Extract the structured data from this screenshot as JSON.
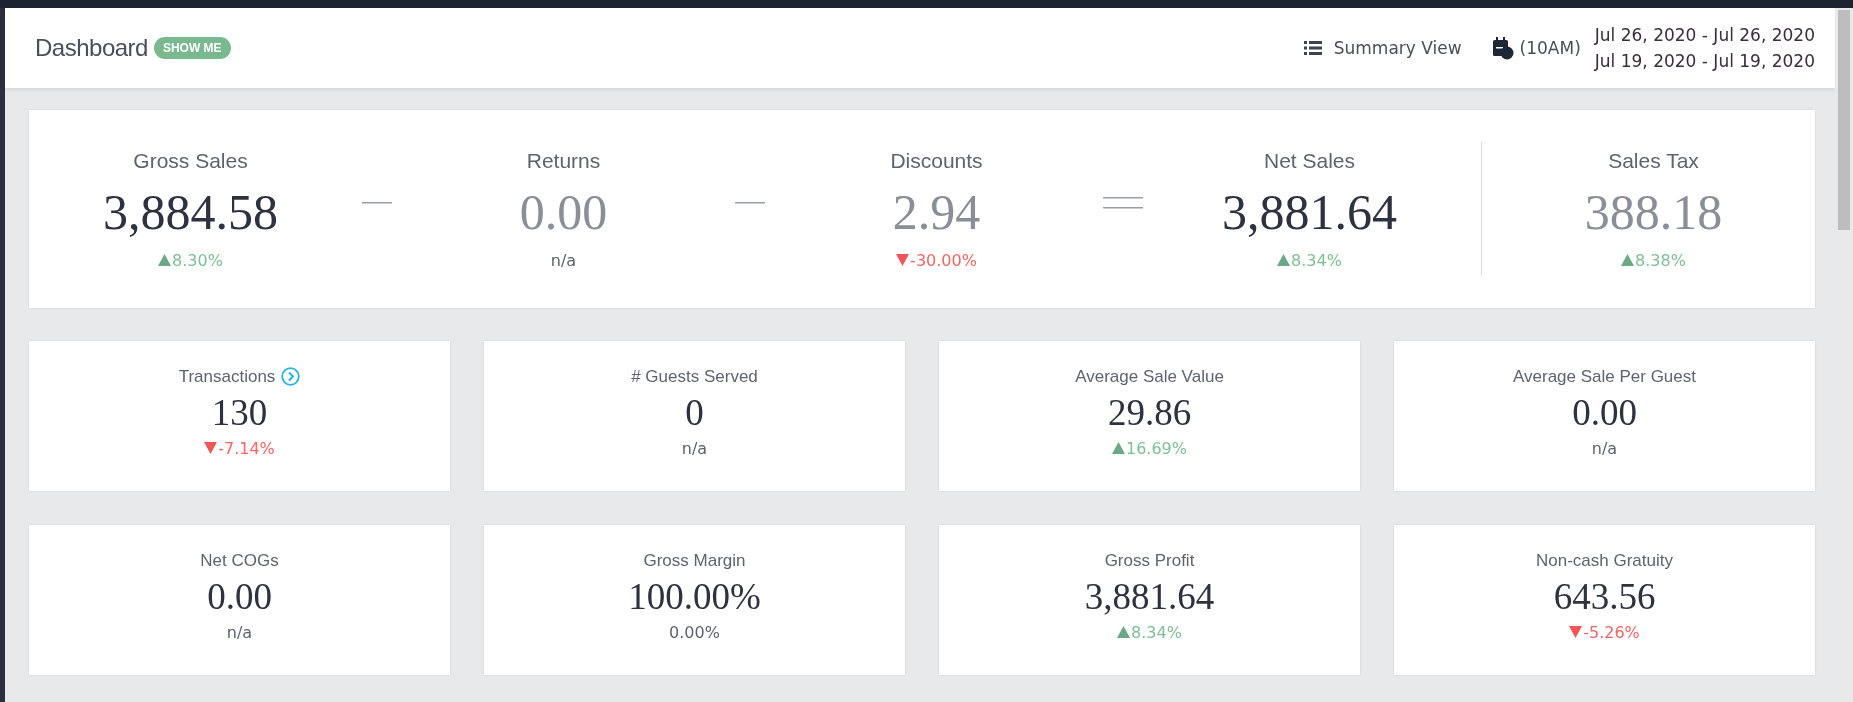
{
  "header": {
    "title": "Dashboard",
    "badge": "SHOW ME",
    "view_button": "Summary View",
    "time_button": "(10AM)",
    "date_ranges": [
      "Jul 26, 2020 - Jul 26, 2020",
      "Jul 19, 2020 - Jul 19, 2020"
    ]
  },
  "summary": [
    {
      "kind": "figure",
      "label": "Gross Sales",
      "value": "3,884.58",
      "muted": false,
      "change": {
        "kind": "up",
        "text": "8.30%"
      }
    },
    {
      "kind": "minus"
    },
    {
      "kind": "figure",
      "label": "Returns",
      "value": "0.00",
      "muted": true,
      "change": {
        "kind": "none",
        "text": "n/a"
      }
    },
    {
      "kind": "minus"
    },
    {
      "kind": "figure",
      "label": "Discounts",
      "value": "2.94",
      "muted": true,
      "change": {
        "kind": "down",
        "text": "-30.00%"
      }
    },
    {
      "kind": "equals"
    },
    {
      "kind": "figure",
      "label": "Net Sales",
      "value": "3,881.64",
      "muted": false,
      "change": {
        "kind": "up",
        "text": "8.34%"
      }
    },
    {
      "kind": "divider"
    },
    {
      "kind": "figure",
      "label": "Sales Tax",
      "value": "388.18",
      "muted": true,
      "change": {
        "kind": "up",
        "text": "8.38%"
      }
    }
  ],
  "metrics": [
    {
      "label": "Transactions",
      "value": "130",
      "change": {
        "kind": "down",
        "text": "-7.14%"
      },
      "link": true
    },
    {
      "label": "# Guests Served",
      "value": "0",
      "change": {
        "kind": "none",
        "text": "n/a"
      },
      "link": false
    },
    {
      "label": "Average Sale Value",
      "value": "29.86",
      "change": {
        "kind": "up",
        "text": "16.69%"
      },
      "link": false
    },
    {
      "label": "Average Sale Per Guest",
      "value": "0.00",
      "change": {
        "kind": "none",
        "text": "n/a"
      },
      "link": false
    },
    {
      "label": "Net COGs",
      "value": "0.00",
      "change": {
        "kind": "none",
        "text": "n/a"
      },
      "link": false
    },
    {
      "label": "Gross Margin",
      "value": "100.00%",
      "change": {
        "kind": "none",
        "text": "0.00%"
      },
      "link": false
    },
    {
      "label": "Gross Profit",
      "value": "3,881.64",
      "change": {
        "kind": "up",
        "text": "8.34%"
      },
      "link": false
    },
    {
      "label": "Non-cash Gratuity",
      "value": "643.56",
      "change": {
        "kind": "down",
        "text": "-5.26%"
      },
      "link": false
    }
  ]
}
